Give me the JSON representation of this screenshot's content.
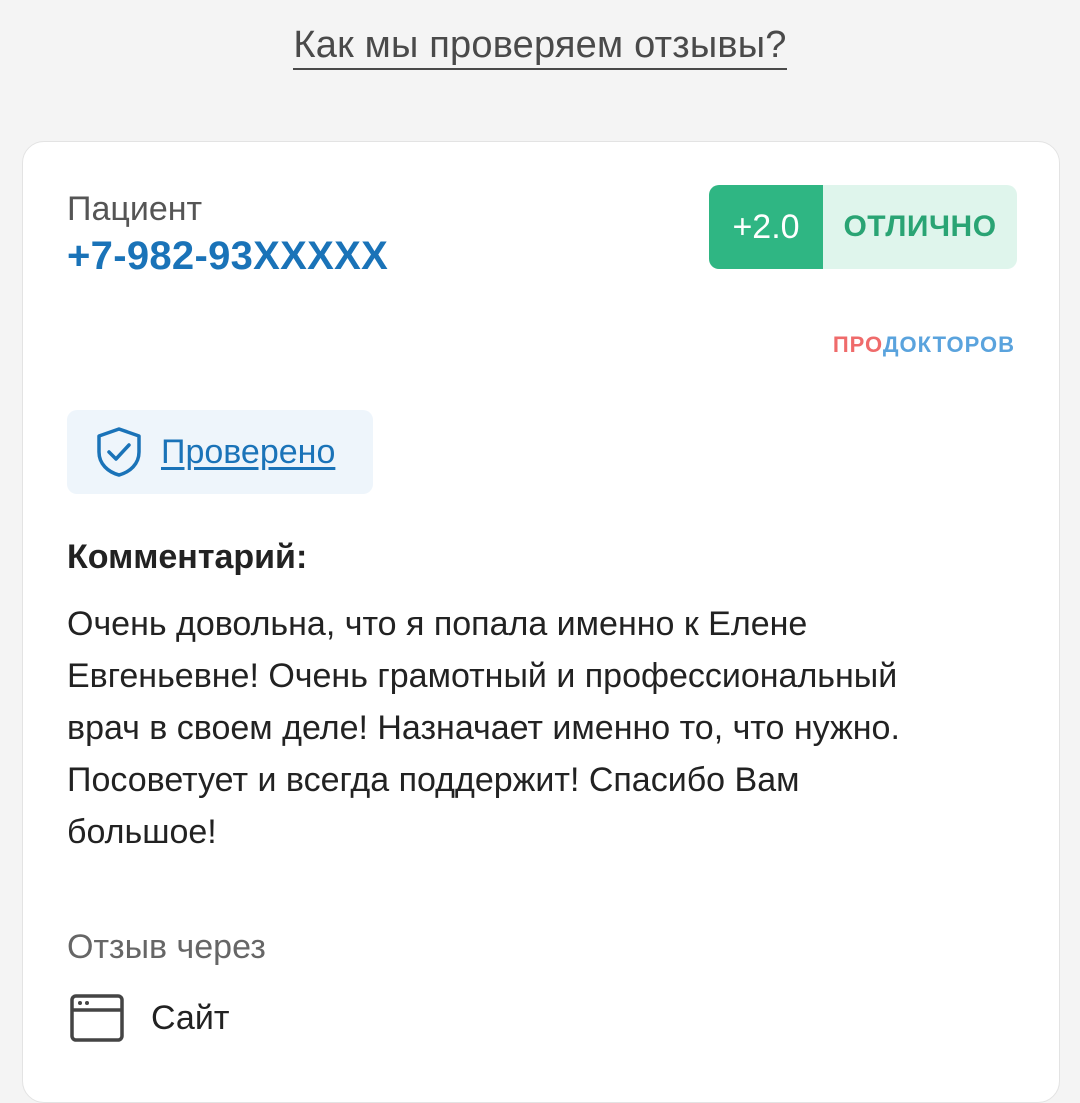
{
  "header": {
    "how_we_check_link": "Как мы проверяем отзывы?"
  },
  "review": {
    "author_label": "Пациент",
    "author_phone": "+7-982-93XXXXX",
    "rating": {
      "score": "+2.0",
      "word": "ОТЛИЧНО",
      "score_bg": "#2fb683",
      "word_bg": "#dff5ec"
    },
    "brand": {
      "part1": "ПРО",
      "part2": "ДОКТОРОВ"
    },
    "verified": {
      "icon": "shield-check-icon",
      "label": "Проверено"
    },
    "comment_title": "Комментарий:",
    "comment_lines": [
      "Очень довольна, что я попала именно к Елене",
      "Евгеньевне! Очень грамотный и профессиональный",
      "врач в своем деле! Назначает именно то, что нужно.",
      "Посоветует и всегда поддержит! Спасибо Вам",
      "большое!"
    ],
    "via_label": "Отзыв через",
    "source": {
      "icon": "browser-window-icon",
      "label": "Сайт"
    }
  },
  "colors": {
    "accent_blue": "#1a73b8",
    "accent_green": "#2fb683",
    "brand_red": "#ef6b6b",
    "brand_blue": "#5aa3dd"
  }
}
